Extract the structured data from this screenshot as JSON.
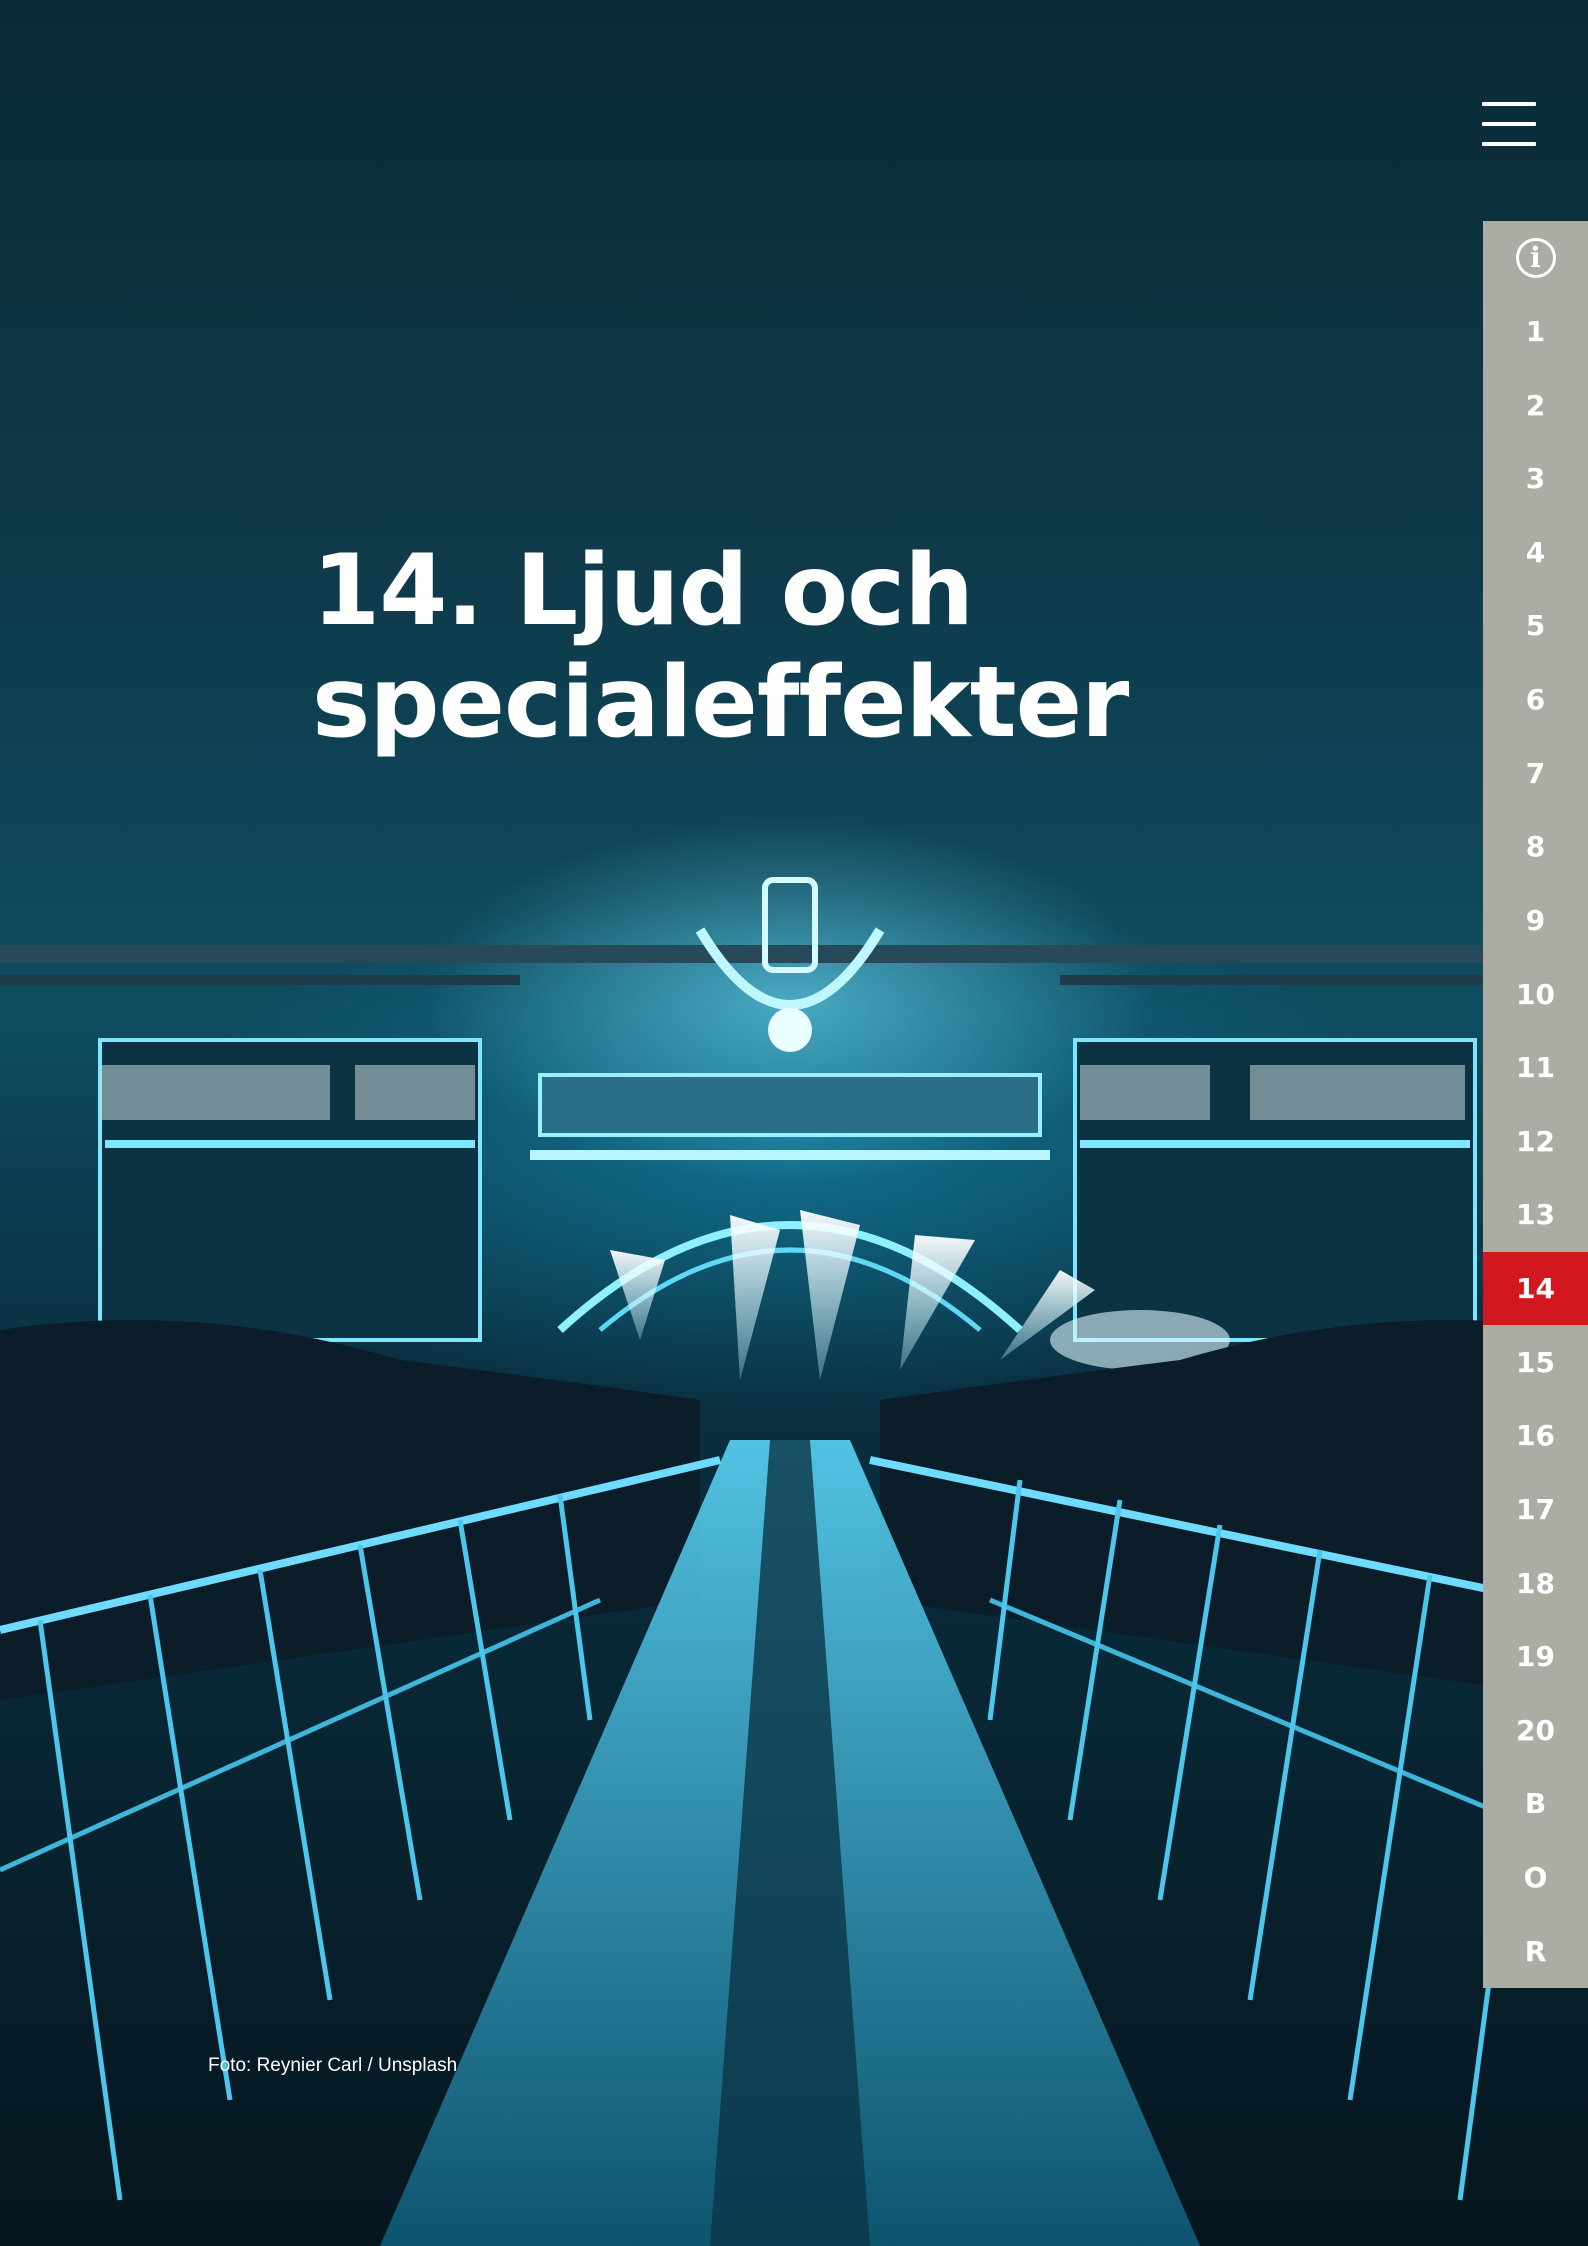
{
  "hero": {
    "title_line1": "14. Ljud och",
    "title_line2": "specialeffekter",
    "photo_credit": "Foto: Reynier Carl / Unsplash",
    "image_description_icon": "concert-stage-photo"
  },
  "header": {
    "menu_icon": "hamburger-menu-icon"
  },
  "nav": {
    "info_icon": "info-icon",
    "info_glyph": "i",
    "items": [
      "1",
      "2",
      "3",
      "4",
      "5",
      "6",
      "7",
      "8",
      "9",
      "10",
      "11",
      "12",
      "13",
      "14",
      "15",
      "16",
      "17",
      "18",
      "19",
      "20",
      "B",
      "O",
      "R"
    ],
    "active": "14"
  },
  "colors": {
    "nav_bg": "#acaca5",
    "nav_active": "#d3171e",
    "text": "#ffffff",
    "accent_glow": "#3fd6ff"
  }
}
